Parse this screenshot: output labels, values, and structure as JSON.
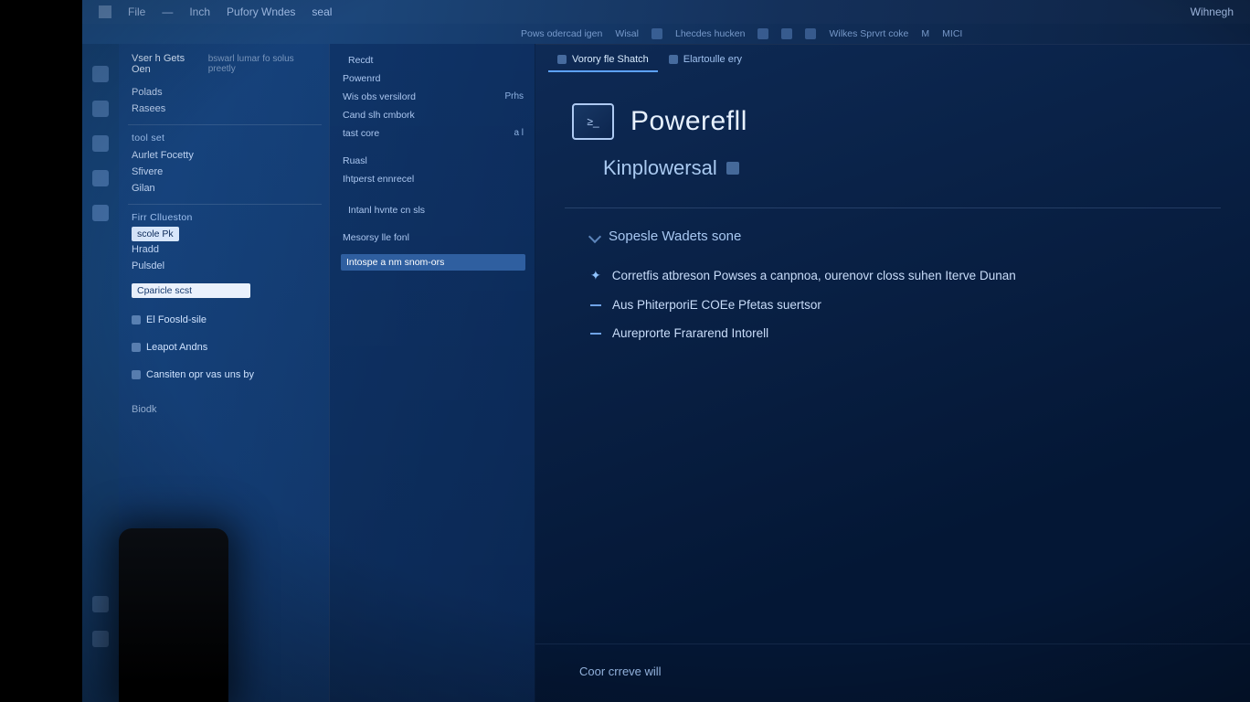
{
  "menubar": {
    "items": [
      "File",
      "—",
      "Inch",
      "Pufory Wndes",
      "seal",
      "Wihnegh"
    ]
  },
  "toolbar2": {
    "items": [
      "Pows odercad igen",
      "Wisal",
      "Lhecdes hucken",
      "Wilkes Sprvrt coke",
      "M",
      "MICI"
    ]
  },
  "panelA": {
    "header": "Vser h Gets Oen",
    "header_sub": "bswarl lumar fo solus preetly",
    "g1": [
      "Polads",
      "Rasees"
    ],
    "g2_title": "tool set",
    "g2_items": [
      "Aurlet Focetty",
      "Sfivere",
      "Gilan"
    ],
    "g3_title": "Firr Cllueston",
    "g3_selected": "scole Pk",
    "g3_items": [
      "Hradd",
      "Pulsdel"
    ],
    "dropdown": "Cparicle scst",
    "links": [
      "El Foosld-sile",
      "Leapot Andns",
      "Cansiten opr vas uns by"
    ],
    "footer": "Biodk"
  },
  "panelB": {
    "items": [
      {
        "label": "Recdt",
        "badge": ""
      },
      {
        "label": "Powenrd",
        "badge": ""
      },
      {
        "label": "Wis obs versilord",
        "badge": "Prhs"
      },
      {
        "label": "Cand slh cmbork",
        "badge": ""
      },
      {
        "label": "tast core",
        "badge": "a l"
      },
      {
        "label": "Ruasl",
        "badge": ""
      },
      {
        "label": "Ihtperst ennrecel",
        "badge": ""
      },
      {
        "label": "Intanl hvnte cn sls",
        "badge": ""
      },
      {
        "label": "Mesorsy lle fonl",
        "badge": ""
      }
    ],
    "active": "Intospe a nm snom-ors"
  },
  "content": {
    "tabs": [
      {
        "label": "Vorory fle Shatch",
        "active": true
      },
      {
        "label": "Elartoulle ery",
        "active": false
      }
    ],
    "hero_badge": "≥_",
    "hero_title": "Powerefll",
    "subtitle": "Kinplowersal",
    "section": "Sopesle Wadets sone",
    "lines": [
      "Corretfis atbreson Powses a canpnoa, ourenovr closs suhen Iterve Dunan",
      "Aus PhiterporiE COEe Pfetas suertsor",
      "Aureprorte Frararend Intorell"
    ],
    "footer": "Coor crreve will"
  }
}
